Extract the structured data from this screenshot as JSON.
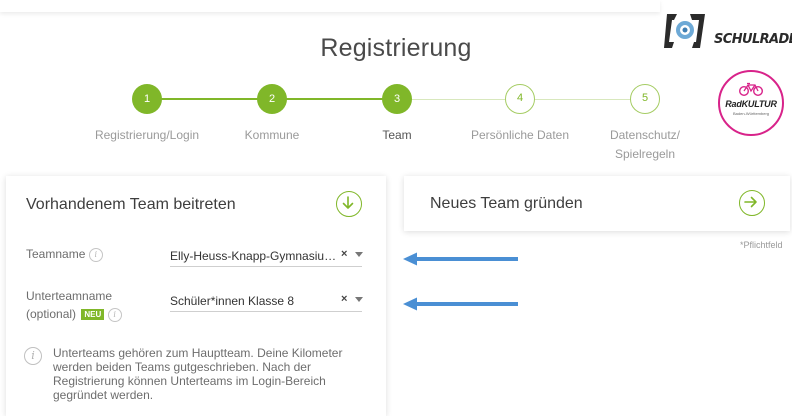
{
  "header": {
    "title": "Registrierung"
  },
  "logos": {
    "schulradeln": "SCHULRADELN",
    "radkultur": "RadKULTUR",
    "radkultur_sub": "Baden-Württemberg"
  },
  "stepper": {
    "steps": [
      {
        "number": "1",
        "label": "Registrierung/Login",
        "state": "done"
      },
      {
        "number": "2",
        "label": "Kommune",
        "state": "done"
      },
      {
        "number": "3",
        "label": "Team",
        "state": "active"
      },
      {
        "number": "4",
        "label": "Persönliche Daten",
        "state": "todo"
      },
      {
        "number": "5",
        "label": "Datenschutz/",
        "label2": "Spielregeln",
        "state": "todo"
      }
    ]
  },
  "join_team": {
    "title": "Vorhandenem Team beitreten",
    "team_label": "Teamname",
    "team_value": "Elly-Heuss-Knapp-Gymnasium Ba...",
    "subteam_label": "Unterteamname",
    "subteam_optional": "(optional)",
    "subteam_badge": "NEU",
    "subteam_value": "Schüler*innen Klasse 8",
    "clear_symbol": "×",
    "hint": "Unterteams gehören zum Hauptteam. Deine Kilometer werden beiden Teams gutgeschrieben. Nach der Registrierung können Unterteams im Login-Bereich gegründet werden."
  },
  "new_team": {
    "title": "Neues Team gründen"
  },
  "required_note": "*Pflichtfeld",
  "colors": {
    "accent_green": "#80b729",
    "annotation_arrow": "#4a8fd4",
    "radkultur_pink": "#d8238a"
  },
  "icons": {
    "info": "i",
    "join_button": "arrow-down-circle-icon",
    "new_team_button": "arrow-right-circle-icon"
  }
}
